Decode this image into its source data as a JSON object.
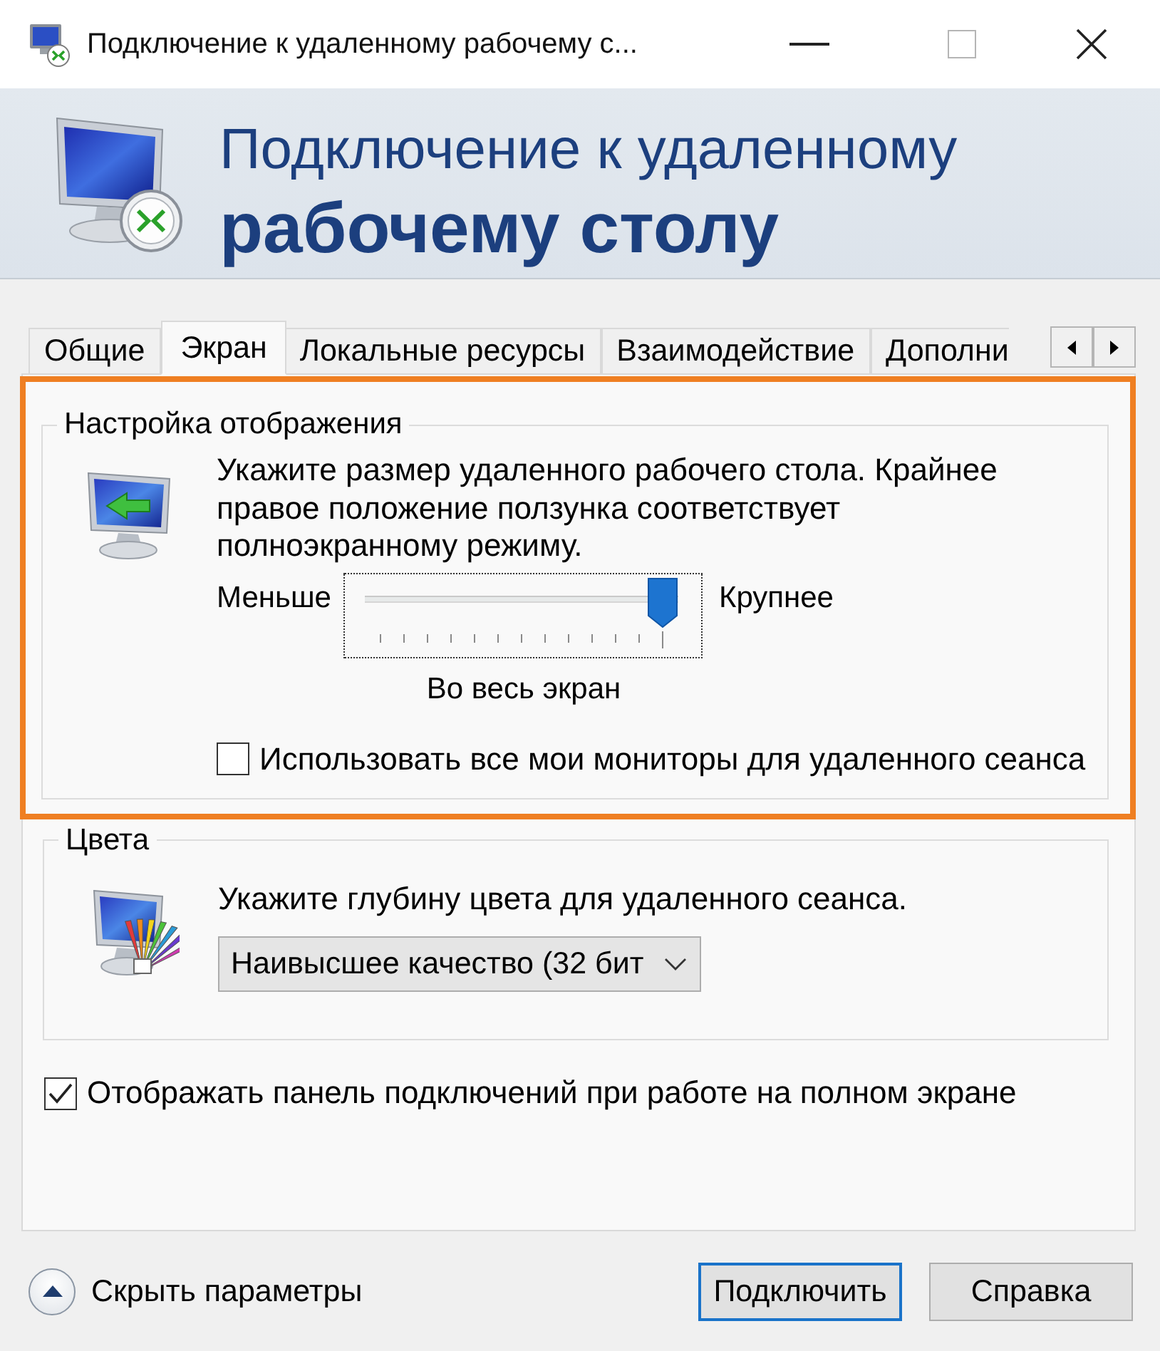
{
  "window": {
    "title": "Подключение к удаленному рабочему с..."
  },
  "header": {
    "title_line_1": "Подключение к удаленному",
    "title_line_2": "рабочему столу"
  },
  "tabs": [
    {
      "label": "Общие",
      "selected": false
    },
    {
      "label": "Экран",
      "selected": true
    },
    {
      "label": "Локальные ресурсы",
      "selected": false
    },
    {
      "label": "Взаимодействие",
      "selected": false
    },
    {
      "label": "Дополни",
      "selected": false
    }
  ],
  "display_settings": {
    "legend": "Настройка отображения",
    "highlighted": true,
    "description": "Укажите размер удаленного рабочего стола. Крайнее\nправое положение ползунка соответствует\nполноэкранному режиму.",
    "slider": {
      "min_label": "Меньше",
      "max_label": "Крупнее",
      "level": 1,
      "caption": "Во весь экран"
    },
    "use_all_monitors": {
      "label": "Использовать все мои мониторы для удаленного сеанса",
      "checked": false
    }
  },
  "colors": {
    "legend": "Цвета",
    "description": "Укажите глубину цвета для удаленного сеанса.",
    "dropdown": {
      "value": "Наивысшее качество (32 бит"
    }
  },
  "show_connection_bar": {
    "label": "Отображать панель подключений при работе на полном экране",
    "checked": true
  },
  "footer": {
    "toggle_label": "Скрыть параметры",
    "buttons": [
      {
        "label": "Подключить",
        "default": true
      },
      {
        "label": "Справка",
        "default": false
      }
    ]
  }
}
